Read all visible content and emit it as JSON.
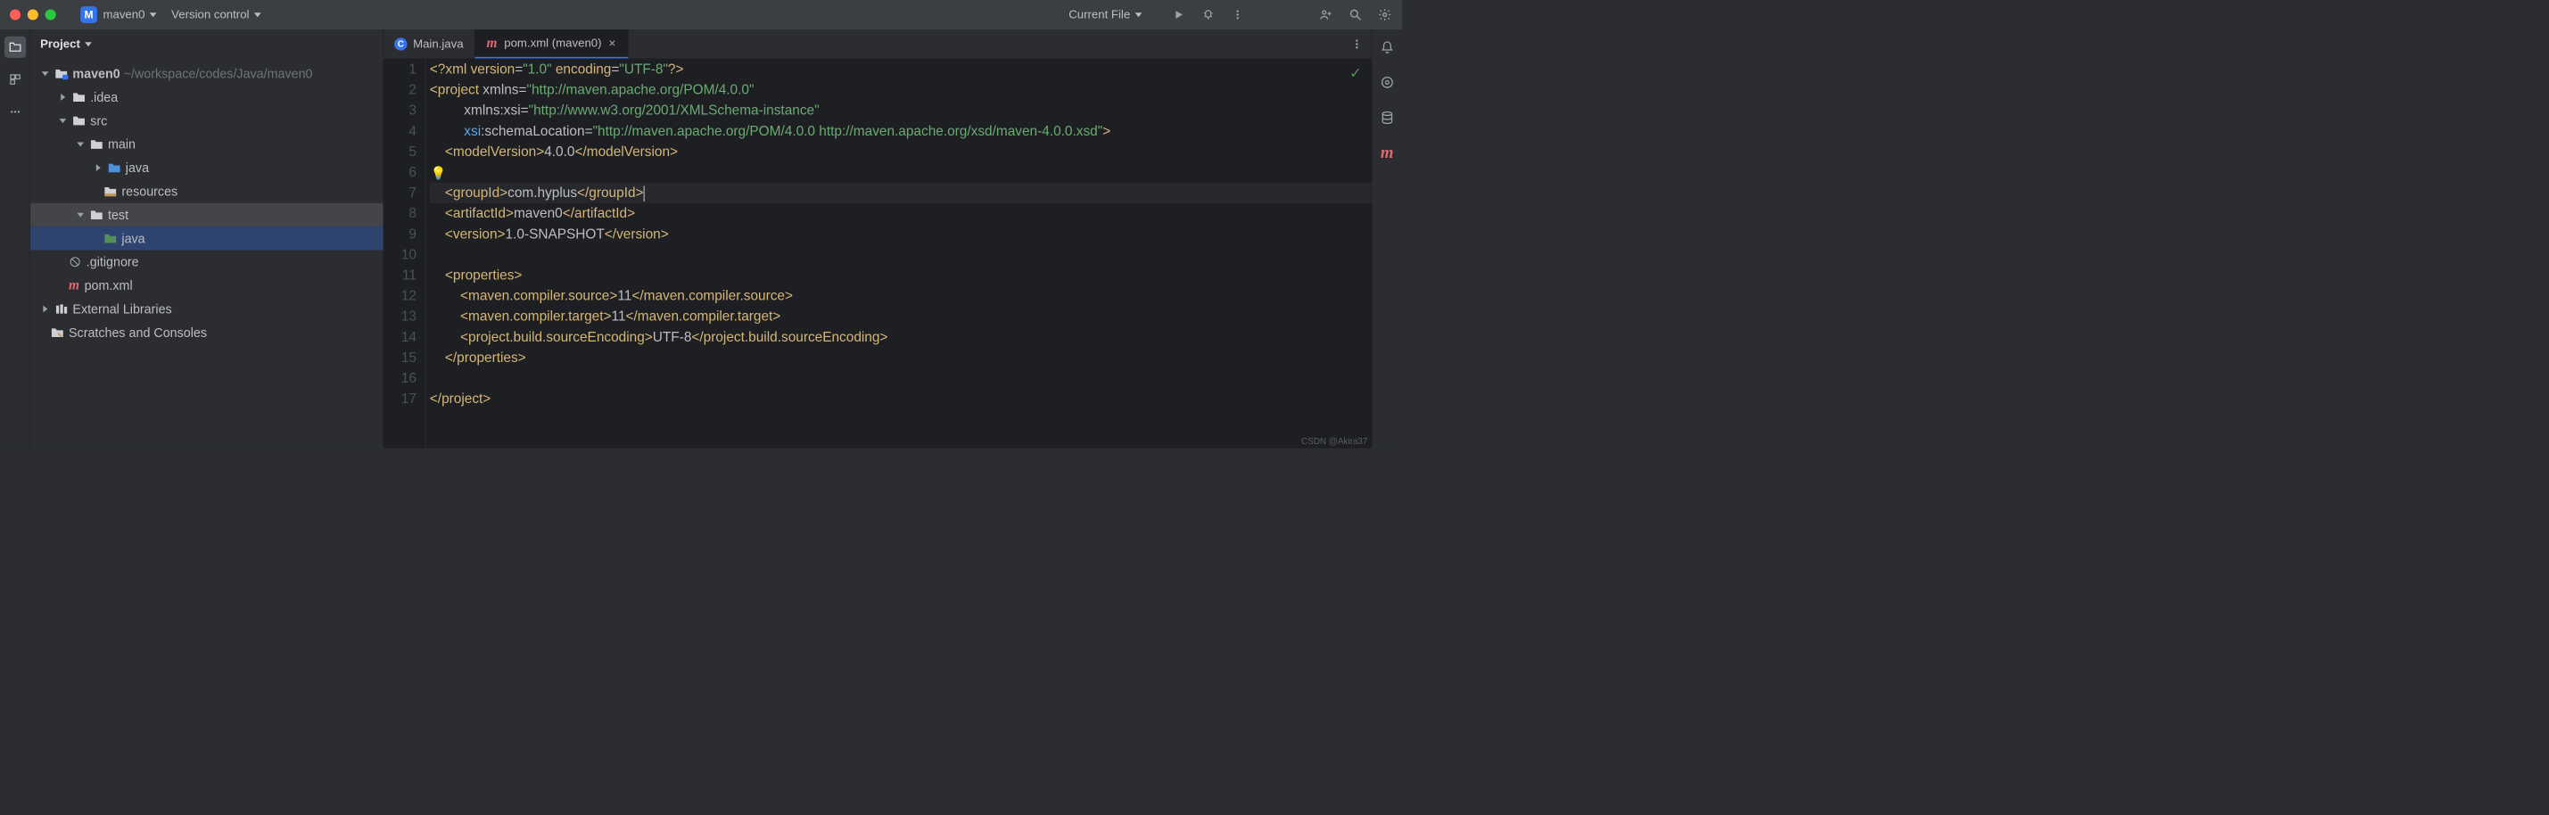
{
  "titlebar": {
    "project_badge": "M",
    "project_name": "maven0",
    "vcs": "Version control",
    "current_file": "Current File"
  },
  "panel": {
    "title": "Project"
  },
  "tree": {
    "root": "maven0",
    "root_path": "~/workspace/codes/Java/maven0",
    "idea": ".idea",
    "src": "src",
    "main": "main",
    "java1": "java",
    "resources": "resources",
    "test": "test",
    "java2": "java",
    "gitignore": ".gitignore",
    "pom": "pom.xml",
    "external": "External Libraries",
    "scratches": "Scratches and Consoles"
  },
  "tabs": {
    "main_java": "Main.java",
    "pom": "pom.xml (maven0)"
  },
  "gutter": [
    "1",
    "2",
    "3",
    "4",
    "5",
    "6",
    "7",
    "8",
    "9",
    "10",
    "11",
    "12",
    "13",
    "14",
    "15",
    "16",
    "17"
  ],
  "code": {
    "l1a": "<?",
    "l1b": "xml version",
    "l1c": "=",
    "l1d": "\"1.0\"",
    "l1e": " encoding",
    "l1f": "=",
    "l1g": "\"UTF-8\"",
    "l1h": "?>",
    "l2a": "<project ",
    "l2b": "xmlns",
    "l2c": "=",
    "l2d": "\"http://maven.apache.org/POM/4.0.0\"",
    "l3a": "         ",
    "l3b": "xmlns:xsi",
    "l3c": "=",
    "l3d": "\"http://www.w3.org/2001/XMLSchema-instance\"",
    "l4a": "         ",
    "l4b": "xsi",
    "l4c": ":schemaLocation",
    "l4d": "=",
    "l4e": "\"http://maven.apache.org/POM/4.0.0 http://maven.apache.org/xsd/maven-4.0.0.xsd\"",
    "l4f": ">",
    "l5a": "    <modelVersion>",
    "l5b": "4.0.0",
    "l5c": "</modelVersion>",
    "l7a": "    <groupId>",
    "l7b": "com.hyplus",
    "l7c": "</groupId>",
    "l8a": "    <artifactId>",
    "l8b": "maven0",
    "l8c": "</artifactId>",
    "l9a": "    <version>",
    "l9b": "1.0-SNAPSHOT",
    "l9c": "</version>",
    "l11a": "    <properties>",
    "l12a": "        <maven.compiler.source>",
    "l12b": "11",
    "l12c": "</maven.compiler.source>",
    "l13a": "        <maven.compiler.target>",
    "l13b": "11",
    "l13c": "</maven.compiler.target>",
    "l14a": "        <project.build.sourceEncoding>",
    "l14b": "UTF-8",
    "l14c": "</project.build.sourceEncoding>",
    "l15a": "    </properties>",
    "l17a": "</project>"
  },
  "watermark": "CSDN @Akira37"
}
